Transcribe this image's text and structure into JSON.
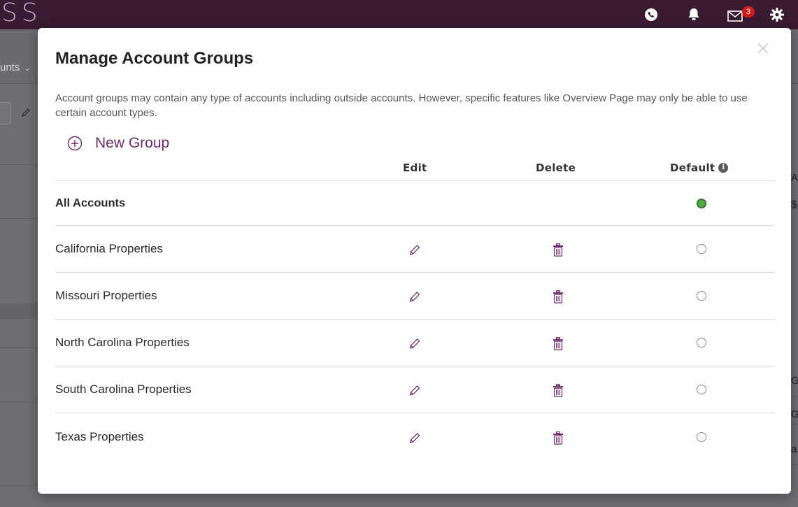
{
  "background": {
    "logo_text": "SS",
    "nav_label": "unts",
    "mail_badge": "3",
    "right_text": [
      "Ar",
      "$",
      "G",
      "G",
      "a"
    ],
    "icons": [
      "phone-icon",
      "bell-icon",
      "mail-icon",
      "gear-icon"
    ]
  },
  "modal": {
    "title": "Manage Account Groups",
    "description": "Account groups may contain any type of accounts including outside accounts. However, specific features like Overview Page may only be able to use certain account types.",
    "new_group_label": "New Group",
    "columns": {
      "edit": "Edit",
      "delete": "Delete",
      "default": "Default"
    },
    "rows": [
      {
        "name": "All Accounts",
        "editable": false,
        "default": true
      },
      {
        "name": "California Properties",
        "editable": true,
        "default": false
      },
      {
        "name": "Missouri Properties",
        "editable": true,
        "default": false
      },
      {
        "name": "North Carolina Properties",
        "editable": true,
        "default": false
      },
      {
        "name": "South Carolina Properties",
        "editable": true,
        "default": false
      },
      {
        "name": "Texas Properties",
        "editable": true,
        "default": false
      }
    ],
    "colors": {
      "accent": "#6e2a6c",
      "default_selected": "#4caf3d",
      "topbar": "#3a1a33"
    }
  }
}
